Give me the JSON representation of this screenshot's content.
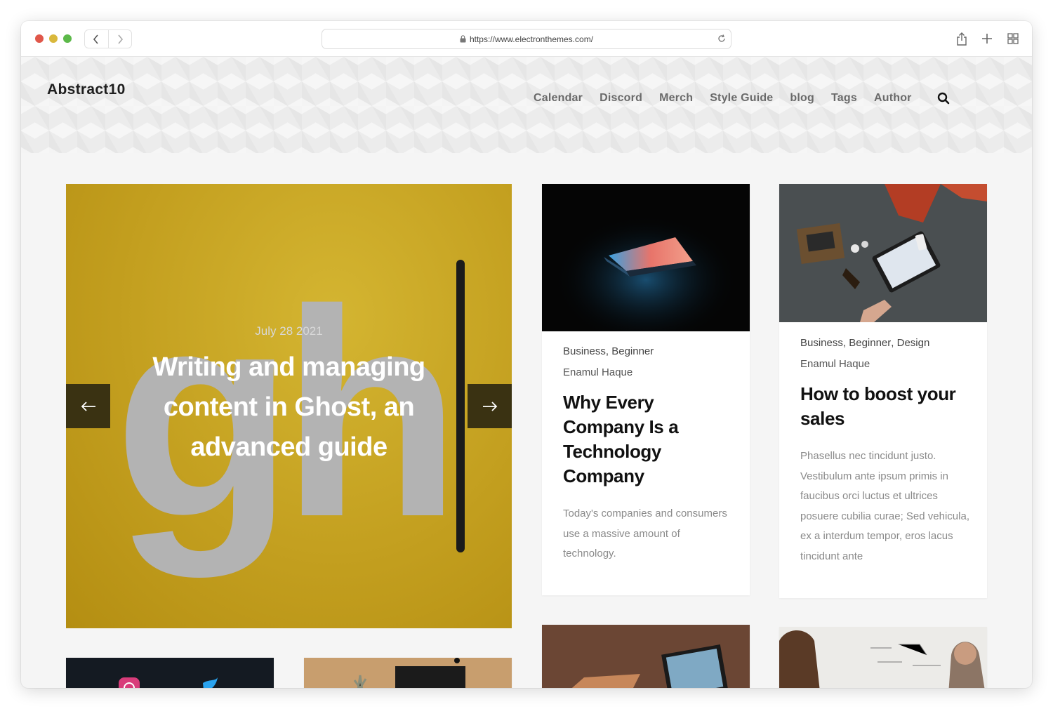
{
  "browser": {
    "url": "https://www.electronthemes.com/"
  },
  "site": {
    "logo": "Abstract10",
    "nav": [
      "Calendar",
      "Discord",
      "Merch",
      "Style Guide",
      "blog",
      "Tags",
      "Author"
    ]
  },
  "hero": {
    "date": "July 28 2021",
    "title": "Writing and managing content in Ghost, an advanced guide",
    "background_letters": "gh",
    "accent": "#c9a41f"
  },
  "cards": [
    {
      "tags": [
        "Business",
        "Beginner"
      ],
      "author": "Enamul Haque",
      "title": "Why Every Company Is a Technology Company",
      "excerpt": "Today's companies and consumers use a massive amount of technology."
    },
    {
      "tags": [
        "Business",
        "Beginner",
        "Design"
      ],
      "author": "Enamul Haque",
      "title": "How to boost your sales",
      "excerpt": "Phasellus nec tincidunt justo. Vestibulum ante ipsum primis in faucibus orci luctus et ultrices posuere cubilia curae; Sed vehicula, ex a interdum tempor, eros lacus tincidunt ante"
    }
  ]
}
